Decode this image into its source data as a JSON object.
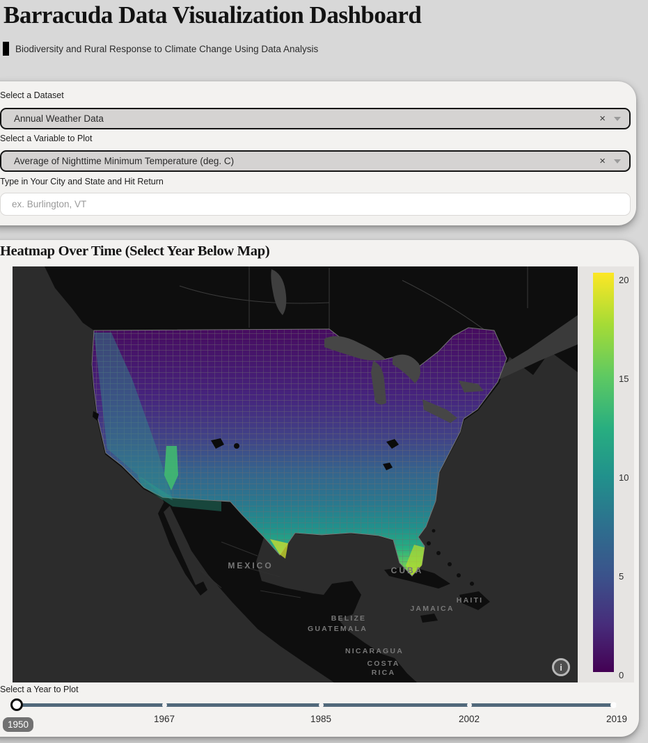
{
  "header": {
    "title": "Barracuda Data Visualization Dashboard",
    "subtitle": "Biodiversity and Rural Response to Climate Change Using Data Analysis"
  },
  "controls": {
    "dataset": {
      "label": "Select a Dataset",
      "value": "Annual Weather Data",
      "clear_icon": "×"
    },
    "variable": {
      "label": "Select a Variable to Plot",
      "value": "Average of Nighttime Minimum Temperature (deg. C)",
      "clear_icon": "×"
    },
    "city": {
      "label": "Type in Your City and State and Hit Return",
      "placeholder": "ex. Burlington, VT",
      "value": ""
    }
  },
  "heatmap": {
    "title": "Heatmap Over Time (Select Year Below Map)",
    "info_icon": "i",
    "basemap_labels": [
      {
        "t": "MEXICO"
      },
      {
        "t": "CUBA"
      },
      {
        "t": "BELIZE"
      },
      {
        "t": "GUATEMALA"
      },
      {
        "t": "NICARAGUA"
      },
      {
        "t": "COSTA RICA"
      },
      {
        "t": "JAMAICA"
      },
      {
        "t": "HAITI"
      }
    ],
    "colorbar": {
      "ticks": [
        "20",
        "15",
        "10",
        "5",
        "0"
      ],
      "min": 0,
      "max": 20
    }
  },
  "year_slider": {
    "label": "Select a Year to Plot",
    "min": 1950,
    "max": 2019,
    "value": 1950,
    "tooltip": "1950",
    "tick_labels": [
      "1967",
      "1985",
      "2002",
      "2019"
    ]
  },
  "chart_data": {
    "type": "heatmap",
    "subtype": "us-county-choropleth",
    "title": "Heatmap Over Time (Select Year Below Map)",
    "dataset": "Annual Weather Data",
    "variable": "Average of Nighttime Minimum Temperature (deg. C)",
    "year": 1950,
    "colormap": "viridis",
    "value_range": [
      0,
      20
    ],
    "colorbar_ticks": [
      20,
      15,
      10,
      5,
      0
    ],
    "legend_position": "right",
    "basemap": "dark",
    "basemap_labels": [
      "MEXICO",
      "CUBA",
      "BELIZE",
      "GUATEMALA",
      "NICARAGUA",
      "COSTA RICA",
      "JAMAICA",
      "HAITI"
    ],
    "spatial_pattern": "Northern border counties ~0-3 deg C (dark purple); values increase southward; Pacific coast ~8-12 (teal); Gulf coast ~13-16 (green); south Texas and south Florida ~18-20 (yellow-green)"
  }
}
